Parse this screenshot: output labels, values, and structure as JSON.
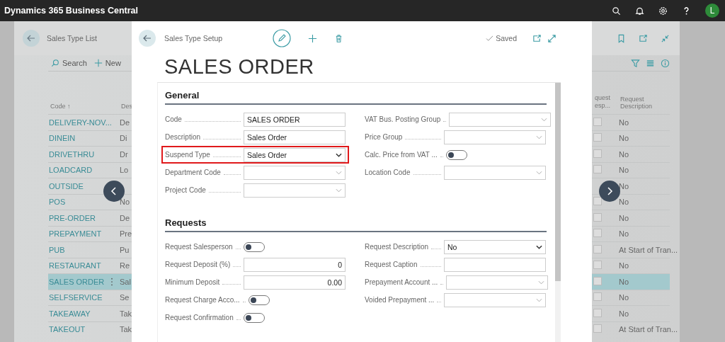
{
  "app_bar": {
    "title": "Dynamics 365 Business Central",
    "avatar": "L"
  },
  "list_page": {
    "title": "Sales Type List",
    "actions": [
      {
        "label": "Search",
        "kind": "search"
      },
      {
        "label": "New",
        "kind": "new"
      }
    ],
    "columns": [
      {
        "label": "Code",
        "sort_mark": "↑"
      },
      {
        "label": "Des"
      },
      {
        "label": "quest esp..."
      },
      {
        "label": "Request Description"
      }
    ],
    "rows": [
      {
        "code": "DELIVERY-NOV...",
        "description": "De",
        "request_desp_checked": false,
        "request_description": "No",
        "selected": false
      },
      {
        "code": "DINEIN",
        "description": "Di",
        "request_desp_checked": false,
        "request_description": "No",
        "selected": false
      },
      {
        "code": "DRIVETHRU",
        "description": "Dr",
        "request_desp_checked": false,
        "request_description": "No",
        "selected": false
      },
      {
        "code": "LOADCARD",
        "description": "Lo",
        "request_desp_checked": false,
        "request_description": "No",
        "selected": false
      },
      {
        "code": "OUTSIDE",
        "request_description": "No",
        "selected": false
      },
      {
        "code": "POS",
        "description": "No",
        "request_desp_checked": false,
        "request_description": "No",
        "selected": false
      },
      {
        "code": "PRE-ORDER",
        "description": "De",
        "request_desp_checked": false,
        "request_description": "No",
        "selected": false
      },
      {
        "code": "PREPAYMENT",
        "description": "Pre",
        "request_desp_checked": false,
        "request_description": "No",
        "selected": false
      },
      {
        "code": "PUB",
        "description": "Pu",
        "request_desp_checked": false,
        "request_description": "At Start of Tran...",
        "selected": false
      },
      {
        "code": "RESTAURANT",
        "description": "Re",
        "request_desp_checked": false,
        "request_description": "No",
        "selected": false
      },
      {
        "code": "SALES ORDER",
        "description": "Sal",
        "request_desp_checked": false,
        "request_description": "No",
        "selected": true
      },
      {
        "code": "SELFSERVICE",
        "description": "Se",
        "request_desp_checked": false,
        "request_description": "No",
        "selected": false
      },
      {
        "code": "TAKEAWAY",
        "description": "Tak",
        "request_desp_checked": false,
        "request_description": "No",
        "selected": false
      },
      {
        "code": "TAKEOUT",
        "description": "Tak",
        "request_desp_checked": false,
        "request_description": "At Start of Tran...",
        "selected": false
      }
    ]
  },
  "dialog": {
    "caption": "Sales Type Setup",
    "status": "Saved",
    "title": "SALES ORDER",
    "sections": [
      {
        "title": "General",
        "left": [
          {
            "label": "Code",
            "kind": "text",
            "value": "SALES ORDER",
            "highlighted": false
          },
          {
            "label": "Description",
            "kind": "text",
            "value": "Sales Order",
            "highlighted": false
          },
          {
            "label": "Suspend Type",
            "kind": "select",
            "value": "Sales Order",
            "highlighted": true
          },
          {
            "label": "Department Code",
            "kind": "lookup",
            "highlighted": false
          },
          {
            "label": "Project Code",
            "kind": "lookup",
            "highlighted": false
          }
        ],
        "right": [
          {
            "label": "VAT Bus. Posting Group",
            "kind": "lookup",
            "highlighted": false
          },
          {
            "label": "Price Group",
            "kind": "lookup",
            "highlighted": false
          },
          {
            "label": "Calc. Price from VAT ...",
            "kind": "toggle",
            "on": false,
            "highlighted": false
          },
          {
            "label": "Location Code",
            "kind": "lookup",
            "highlighted": false
          }
        ]
      },
      {
        "title": "Requests",
        "left": [
          {
            "label": "Request Salesperson",
            "kind": "toggle",
            "on": false,
            "highlighted": false
          },
          {
            "label": "Request Deposit (%)",
            "kind": "number",
            "value": "0",
            "highlighted": false
          },
          {
            "label": "Minimum Deposit",
            "kind": "number",
            "value": "0.00",
            "highlighted": false
          },
          {
            "label": "Request Charge Acco...",
            "kind": "toggle",
            "on": false,
            "highlighted": false
          },
          {
            "label": "Request Confirmation",
            "kind": "toggle",
            "on": false,
            "highlighted": false
          }
        ],
        "right": [
          {
            "label": "Request Description",
            "kind": "select",
            "value": "No",
            "highlighted": false
          },
          {
            "label": "Request Caption",
            "kind": "text",
            "highlighted": false
          },
          {
            "label": "Prepayment Account ...",
            "kind": "lookup",
            "highlighted": false
          },
          {
            "label": "Voided Prepayment ...",
            "kind": "lookup",
            "highlighted": false
          }
        ]
      }
    ]
  }
}
